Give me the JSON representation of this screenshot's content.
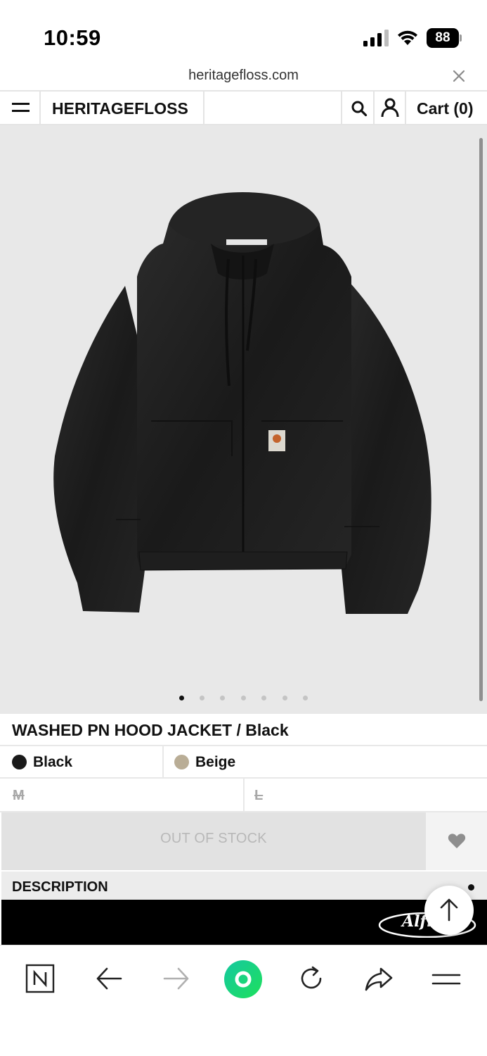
{
  "status_bar": {
    "time": "10:59",
    "battery": "88"
  },
  "browser": {
    "url": "heritagefloss.com",
    "close_icon": "close-icon"
  },
  "header": {
    "brand": "HERITAGEFLOSS",
    "cart_label": "Cart (0)",
    "icons": [
      "menu-icon",
      "search-icon",
      "user-icon"
    ]
  },
  "product": {
    "gallery": {
      "slide_count": 7,
      "active_slide": 1
    },
    "title": "WASHED PN HOOD JACKET / Black",
    "colors": [
      {
        "label": "Black",
        "swatch": "#1a1a1a",
        "selected": true
      },
      {
        "label": "Beige",
        "swatch": "#b9ad96",
        "selected": false
      }
    ],
    "sizes": [
      {
        "label": "M",
        "available": false
      },
      {
        "label": "L",
        "available": false
      }
    ],
    "stock_button": "OUT OF STOCK",
    "wishlist_icon": "heart-icon",
    "description_label": "DESCRIPTION"
  },
  "banner": {
    "logo_text": "Alfred"
  },
  "colors": {
    "hero_bg": "#e8e8e8",
    "oos_bg": "#e2e2e2",
    "oos_text": "#b8b8b8",
    "reload_accent": "#1ed47a"
  },
  "toolbar": {
    "icons": [
      "naver-icon",
      "back-arrow-icon",
      "forward-arrow-icon",
      "home-circle-icon",
      "reload-icon",
      "share-icon",
      "menu-lines-icon"
    ]
  }
}
